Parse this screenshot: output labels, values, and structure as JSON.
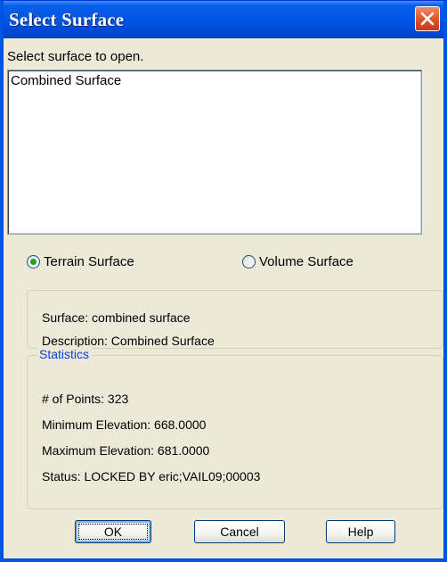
{
  "window": {
    "title": "Select Surface"
  },
  "prompt": "Select surface to open.",
  "surface_list": {
    "items": [
      "Combined Surface"
    ]
  },
  "surface_type": {
    "options": [
      {
        "label": "Terrain Surface",
        "selected": true
      },
      {
        "label": "Volume Surface",
        "selected": false
      }
    ]
  },
  "details": {
    "surface": "Surface: combined surface",
    "description": "Description: Combined Surface"
  },
  "statistics": {
    "legend": "Statistics",
    "points": "# of Points: 323",
    "min_elevation": "Minimum Elevation: 668.0000",
    "max_elevation": "Maximum Elevation: 681.0000",
    "status": "Status: LOCKED BY eric;VAIL09;00003"
  },
  "buttons": {
    "ok": "OK",
    "cancel": "Cancel",
    "help": "Help"
  },
  "icons": {
    "close": "close-icon",
    "radio_on": "radio-selected-icon",
    "radio_off": "radio-unselected-icon"
  },
  "colors": {
    "titlebar": "#0055e5",
    "close": "#e45a32",
    "legend": "#0046d5",
    "radio_dot": "#21a121"
  }
}
